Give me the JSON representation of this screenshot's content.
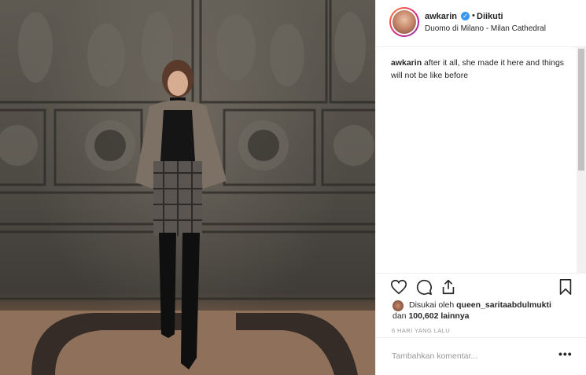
{
  "post": {
    "username": "awkarin",
    "follow_status": "Diikuti",
    "separator": "•",
    "location": "Duomo di Milano - Milan Cathedral",
    "caption_user": "awkarin",
    "caption_text": "after it all, she made it here and things will not be like before",
    "liked_by_prefix": "Disukai oleh",
    "liked_by_user": "queen_saritaabdulmukti",
    "liked_by_and": "dan",
    "likes_count": "100,602",
    "likes_suffix": "lainnya",
    "time_ago": "6 HARI YANG LALU",
    "comment_placeholder": "Tambahkan komentar...",
    "more_glyph": "•••",
    "verified_glyph": "✓"
  },
  "icons": {
    "like": "heart-icon",
    "comment": "comment-icon",
    "share": "share-icon",
    "save": "bookmark-icon",
    "verified": "verified-badge-icon"
  },
  "colors": {
    "verified": "#3897f0",
    "text": "#262626",
    "muted": "#999999",
    "border": "#efefef"
  }
}
